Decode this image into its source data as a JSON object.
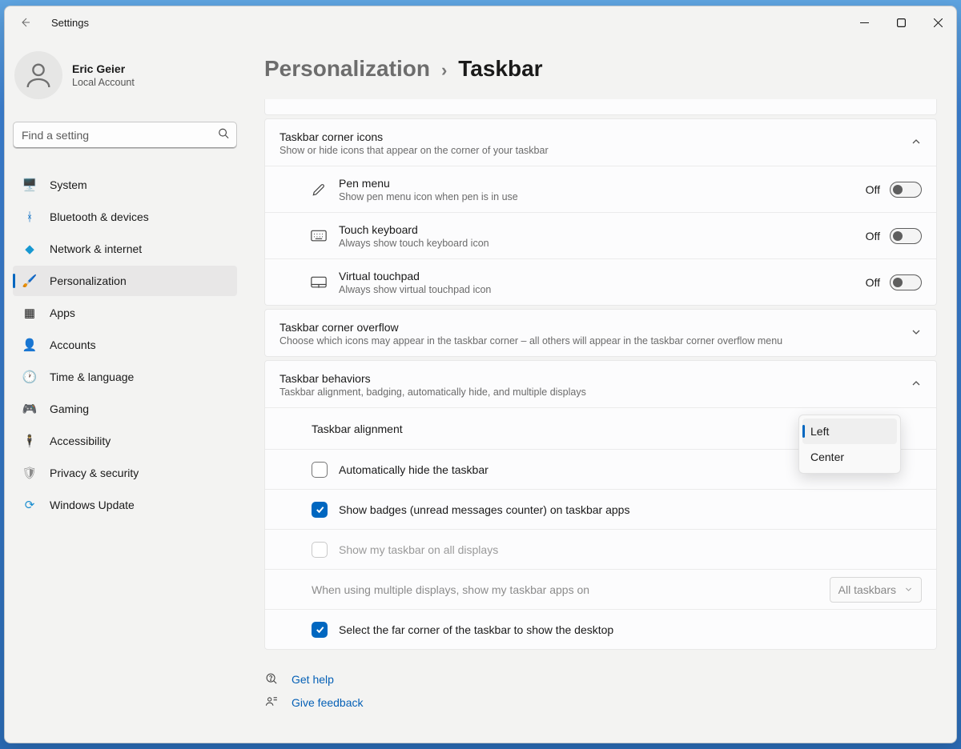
{
  "window": {
    "app_title": "Settings"
  },
  "account": {
    "name": "Eric Geier",
    "subtitle": "Local Account"
  },
  "search": {
    "placeholder": "Find a setting"
  },
  "nav": {
    "items": [
      {
        "label": "System",
        "icon": "monitor-icon"
      },
      {
        "label": "Bluetooth & devices",
        "icon": "bluetooth-icon"
      },
      {
        "label": "Network & internet",
        "icon": "wifi-icon"
      },
      {
        "label": "Personalization",
        "icon": "paint-icon",
        "active": true
      },
      {
        "label": "Apps",
        "icon": "apps-icon"
      },
      {
        "label": "Accounts",
        "icon": "person-icon"
      },
      {
        "label": "Time & language",
        "icon": "clock-icon"
      },
      {
        "label": "Gaming",
        "icon": "gamepad-icon"
      },
      {
        "label": "Accessibility",
        "icon": "accessibility-icon"
      },
      {
        "label": "Privacy & security",
        "icon": "shield-icon"
      },
      {
        "label": "Windows Update",
        "icon": "update-icon"
      }
    ]
  },
  "breadcrumb": {
    "parent": "Personalization",
    "current": "Taskbar"
  },
  "sections": {
    "cornerIcons": {
      "title": "Taskbar corner icons",
      "subtitle": "Show or hide icons that appear on the corner of your taskbar",
      "expanded": true,
      "rows": [
        {
          "title": "Pen menu",
          "subtitle": "Show pen menu icon when pen is in use",
          "state": "Off"
        },
        {
          "title": "Touch keyboard",
          "subtitle": "Always show touch keyboard icon",
          "state": "Off"
        },
        {
          "title": "Virtual touchpad",
          "subtitle": "Always show virtual touchpad icon",
          "state": "Off"
        }
      ]
    },
    "overflow": {
      "title": "Taskbar corner overflow",
      "subtitle": "Choose which icons may appear in the taskbar corner – all others will appear in the taskbar corner overflow menu",
      "expanded": false
    },
    "behaviors": {
      "title": "Taskbar behaviors",
      "subtitle": "Taskbar alignment, badging, automatically hide, and multiple displays",
      "expanded": true,
      "alignment_label": "Taskbar alignment",
      "alignment_options": {
        "left": "Left",
        "center": "Center"
      },
      "alignment_selected": "Left",
      "checks": {
        "autohide": "Automatically hide the taskbar",
        "badges": "Show badges (unread messages counter) on taskbar apps",
        "alldisplays": "Show my taskbar on all displays",
        "farcorner": "Select the far corner of the taskbar to show the desktop"
      },
      "multimon_label": "When using multiple displays, show my taskbar apps on",
      "multimon_value": "All taskbars"
    }
  },
  "footer": {
    "help": "Get help",
    "feedback": "Give feedback"
  }
}
